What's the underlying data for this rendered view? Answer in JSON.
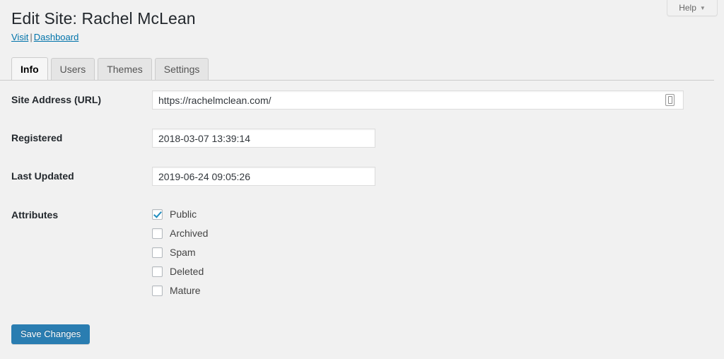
{
  "help": {
    "label": "Help",
    "caret": "▼"
  },
  "header": {
    "title": "Edit Site: Rachel McLean",
    "links": {
      "visit": "Visit",
      "separator": "|",
      "dashboard": "Dashboard"
    }
  },
  "tabs": [
    {
      "label": "Info",
      "active": true
    },
    {
      "label": "Users",
      "active": false
    },
    {
      "label": "Themes",
      "active": false
    },
    {
      "label": "Settings",
      "active": false
    }
  ],
  "form": {
    "site_address": {
      "label": "Site Address (URL)",
      "value": "https://rachelmclean.com/"
    },
    "registered": {
      "label": "Registered",
      "value": "2018-03-07 13:39:14"
    },
    "last_updated": {
      "label": "Last Updated",
      "value": "2019-06-24 09:05:26"
    },
    "attributes": {
      "label": "Attributes",
      "items": [
        {
          "label": "Public",
          "checked": true
        },
        {
          "label": "Archived",
          "checked": false
        },
        {
          "label": "Spam",
          "checked": false
        },
        {
          "label": "Deleted",
          "checked": false
        },
        {
          "label": "Mature",
          "checked": false
        }
      ]
    }
  },
  "submit": {
    "save_label": "Save Changes"
  },
  "colors": {
    "accent": "#0073aa",
    "button": "#2a7db1",
    "checkmark": "#1e8cbe",
    "page_bg": "#f1f1f1"
  }
}
